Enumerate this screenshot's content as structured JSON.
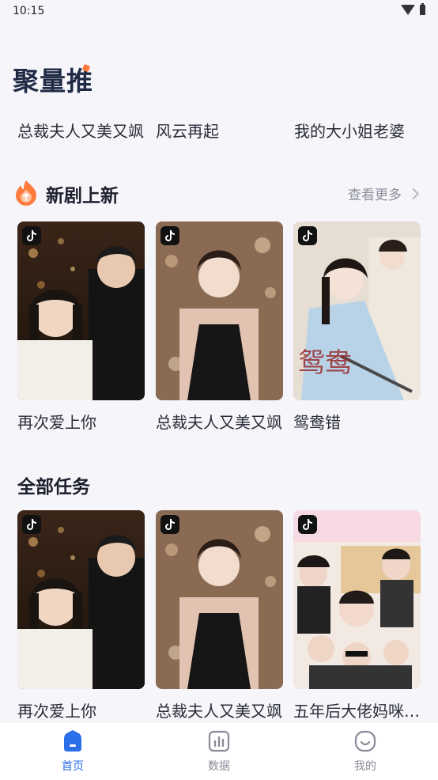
{
  "status": {
    "time": "10:15"
  },
  "brand": {
    "title": "聚量推"
  },
  "hot": [
    "总裁夫人又美又飒",
    "风云再起",
    "我的大小姐老婆"
  ],
  "new_dramas": {
    "title": "新剧上新",
    "more_label": "查看更多",
    "items": [
      {
        "title": "再次爱上你"
      },
      {
        "title": "总裁夫人又美又飒"
      },
      {
        "title": "鸳鸯错"
      }
    ]
  },
  "all_tasks": {
    "title": "全部任务",
    "items": [
      {
        "title": "再次爱上你"
      },
      {
        "title": "总裁夫人又美又飒"
      },
      {
        "title": "五年后大佬妈咪又美又飒"
      }
    ]
  },
  "tabbar": {
    "items": [
      {
        "label": "首页",
        "icon": "home-icon",
        "active": true
      },
      {
        "label": "数据",
        "icon": "chart-icon",
        "active": false
      },
      {
        "label": "我的",
        "icon": "profile-icon",
        "active": false
      }
    ]
  },
  "colors": {
    "accent": "#2a6ee8",
    "brand_orange": "#ff7a3d"
  }
}
